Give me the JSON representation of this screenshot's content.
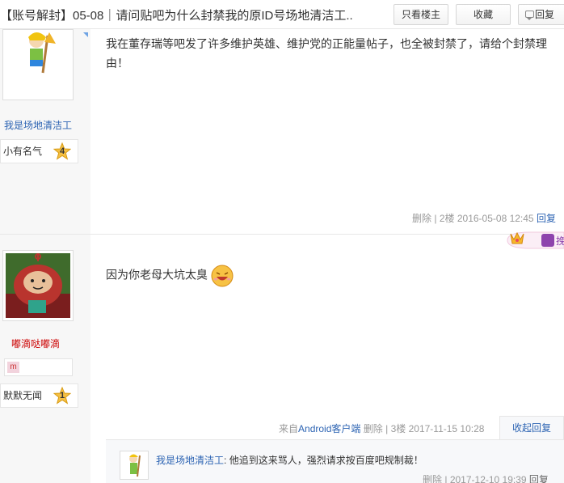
{
  "header": {
    "title": "【账号解封】05-08｜请问贴吧为什么封禁我的原ID号场地清洁工..",
    "btn_only_op": "只看楼主",
    "btn_favorite": "收藏",
    "btn_reply": "回复"
  },
  "posts": [
    {
      "username": "我是场地清洁工",
      "level_name": "小有名气",
      "level": "4",
      "content": "我在董存瑞等吧发了许多维护英雄、维护党的正能量帖子，也全被封禁了，请给个封禁理由！",
      "delete": "删除",
      "sep": "|",
      "floor": "2楼",
      "time": "2016-05-08 12:45",
      "reply": "回复"
    },
    {
      "username": "嘟滴哒嘟滴",
      "badge_letter": "m",
      "level_name": "默默无闻",
      "level": "1",
      "content": "因为你老母大坑太臭",
      "source_prefix": "来自",
      "source_link": "Android客户端",
      "delete": "删除",
      "sep": "|",
      "floor": "3楼",
      "time": "2017-11-15 10:28",
      "fold_reply": "收起回复",
      "sub_reply": {
        "username": "我是场地清洁工",
        "colon": ":",
        "text": "他追到这来骂人，强烈请求按百度吧规制裁！",
        "delete": "删除",
        "sep": "|",
        "time": "2017-12-10 19:39",
        "reply": "回复"
      }
    }
  ],
  "colors": {
    "link": "#2d64b3",
    "side_bg": "#f7f7f7",
    "accent_red": "#cc0000"
  },
  "icons": [
    "chat-bubble-icon",
    "level-star-icon",
    "smile-emoji-icon",
    "crown-icon",
    "badge-m-icon"
  ]
}
